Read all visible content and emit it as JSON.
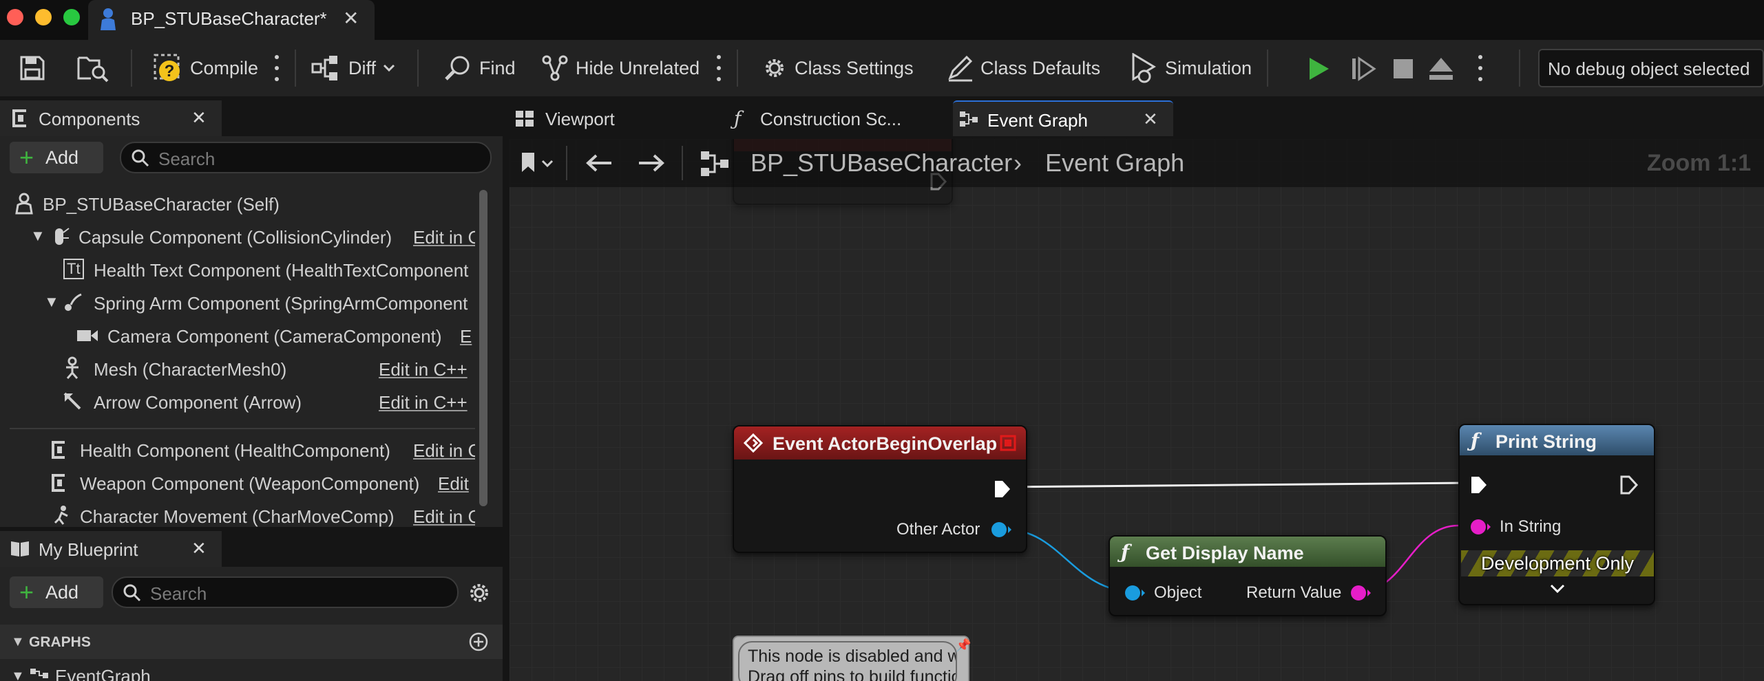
{
  "window": {
    "title": "BP_STUBaseCharacter*"
  },
  "toolbar": {
    "compile": "Compile",
    "diff": "Diff",
    "find": "Find",
    "hide_unrelated": "Hide Unrelated",
    "class_settings": "Class Settings",
    "class_defaults": "Class Defaults",
    "simulation": "Simulation",
    "debug_object": "No debug object selected"
  },
  "components_panel": {
    "tab": "Components",
    "add": "Add",
    "search_placeholder": "Search",
    "items": [
      {
        "label": "BP_STUBaseCharacter (Self)",
        "edit": ""
      },
      {
        "label": "Capsule Component (CollisionCylinder)",
        "edit": "Edit in C"
      },
      {
        "label": "Health Text Component (HealthTextComponent",
        "edit": ""
      },
      {
        "label": "Spring Arm Component (SpringArmComponent",
        "edit": ""
      },
      {
        "label": "Camera Component (CameraComponent)",
        "edit": "E"
      },
      {
        "label": "Mesh (CharacterMesh0)",
        "edit": "Edit in C++"
      },
      {
        "label": "Arrow Component (Arrow)",
        "edit": "Edit in C++"
      },
      {
        "label": "Health Component (HealthComponent)",
        "edit": "Edit in C"
      },
      {
        "label": "Weapon Component (WeaponComponent)",
        "edit": "Edit"
      },
      {
        "label": "Character Movement (CharMoveComp)",
        "edit": "Edit in C"
      }
    ]
  },
  "my_blueprint": {
    "tab": "My Blueprint",
    "add": "Add",
    "search_placeholder": "Search",
    "graphs_header": "GRAPHS",
    "graph_item": "EventGraph"
  },
  "editor_tabs": [
    "Viewport",
    "Construction Sc...",
    "Event Graph"
  ],
  "breadcrumb": {
    "blueprint": "BP_STUBaseCharacter",
    "graph": "Event Graph",
    "zoom": "Zoom 1:1"
  },
  "nodes": {
    "begin_overlap": {
      "title": "Event ActorBeginOverlap",
      "pin_other_actor": "Other Actor"
    },
    "get_display_name": {
      "title": "Get Display Name",
      "pin_object": "Object",
      "pin_return": "Return Value"
    },
    "print_string": {
      "title": "Print String",
      "pin_in_string": "In String",
      "banner": "Development Only"
    },
    "comment": {
      "line1": "This node is disabled and will not be called.",
      "line2": "Drag off pins to build functionality."
    }
  },
  "colors": {
    "event_header": "#8a1c1c",
    "function_header": "#3d5a75",
    "pure_header": "#4b6b40",
    "object_pin": "#1a9cde",
    "string_pin": "#e61ec8",
    "play_green": "#3fb43f"
  }
}
